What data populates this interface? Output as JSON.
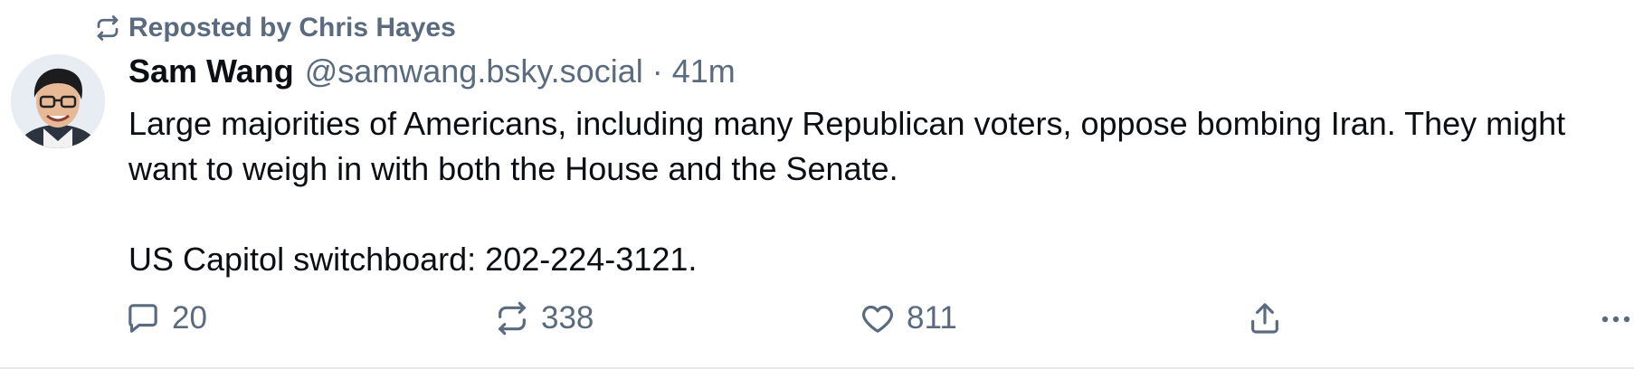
{
  "repost": {
    "icon": "repost-icon",
    "label": "Reposted by Chris Hayes"
  },
  "author": {
    "avatar": "avatar-photo",
    "name": "Sam Wang",
    "handle": "@samwang.bsky.social",
    "separator": "·",
    "time": "41m"
  },
  "post": {
    "paragraph1": "Large majorities of Americans, including many Republican voters, oppose bombing Iran. They might want to weigh in with both the House and the Senate.",
    "paragraph2": "US Capitol switchboard: 202-224-3121."
  },
  "actions": {
    "reply": {
      "icon": "reply-bubble-icon",
      "count": "20"
    },
    "repost": {
      "icon": "repost-icon",
      "count": "338"
    },
    "like": {
      "icon": "heart-icon",
      "count": "811"
    },
    "share": {
      "icon": "share-icon"
    },
    "more": {
      "icon": "more-dots-icon"
    }
  },
  "colors": {
    "text": "#0b0f14",
    "muted": "#5a6b80",
    "divider": "#e3e8ee"
  }
}
